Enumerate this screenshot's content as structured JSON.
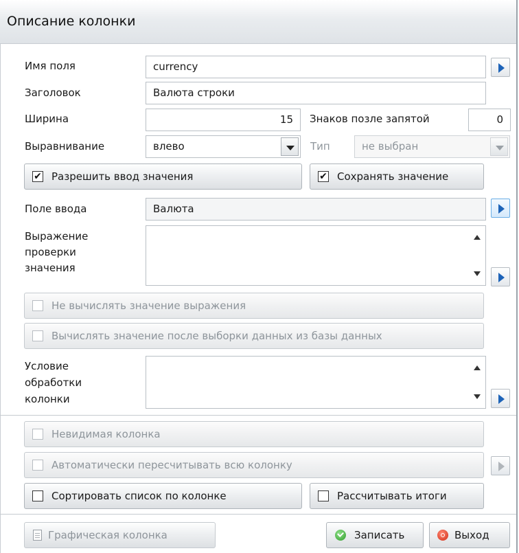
{
  "window": {
    "title": "Описание колонки"
  },
  "fields": {
    "name": {
      "label": "Имя поля",
      "value": "currency"
    },
    "header": {
      "label": "Заголовок",
      "value": "Валюта строки"
    },
    "width": {
      "label": "Ширина",
      "value": "15"
    },
    "decimals": {
      "label": "Знаков позле запятой",
      "value": "0"
    },
    "align": {
      "label": "Выравнивание",
      "value": "влево"
    },
    "type": {
      "label": "Тип",
      "value": "не выбран"
    },
    "input": {
      "label": "Поле ввода",
      "value": "Валюта"
    },
    "check_expr": {
      "label_lines": [
        "Выражение",
        "проверки",
        "значения"
      ],
      "value": ""
    },
    "process_cond": {
      "label_lines": [
        "Условие",
        "обработки",
        "колонки"
      ],
      "value": ""
    }
  },
  "checkboxes": {
    "allow_input": {
      "label": "Разрешить ввод значения",
      "checked": true,
      "mark": "✔"
    },
    "save_value": {
      "label": "Сохранять значение",
      "checked": true,
      "mark": "✔"
    },
    "no_calc": {
      "label": "Не вычислять значение выражения",
      "checked": false,
      "mark": ""
    },
    "calc_after": {
      "label": "Вычислять значение после выборки данных из базы данных",
      "checked": false,
      "mark": ""
    },
    "invisible": {
      "label": "Невидимая колонка",
      "checked": false,
      "mark": ""
    },
    "auto_recalc": {
      "label": "Автоматически пересчитывать всю колонку",
      "checked": false,
      "mark": ""
    },
    "sort_list": {
      "label": "Сортировать список по колонке",
      "checked": false,
      "mark": ""
    },
    "totals": {
      "label": "Рассчитывать итоги",
      "checked": false,
      "mark": ""
    }
  },
  "buttons": {
    "graphic": "Графическая колонка",
    "save": "Записать",
    "exit": "Выход"
  },
  "colors": {
    "accent_arrow": "#1d63b8",
    "ok": "#2e9c2a",
    "exit": "#d12a14"
  }
}
